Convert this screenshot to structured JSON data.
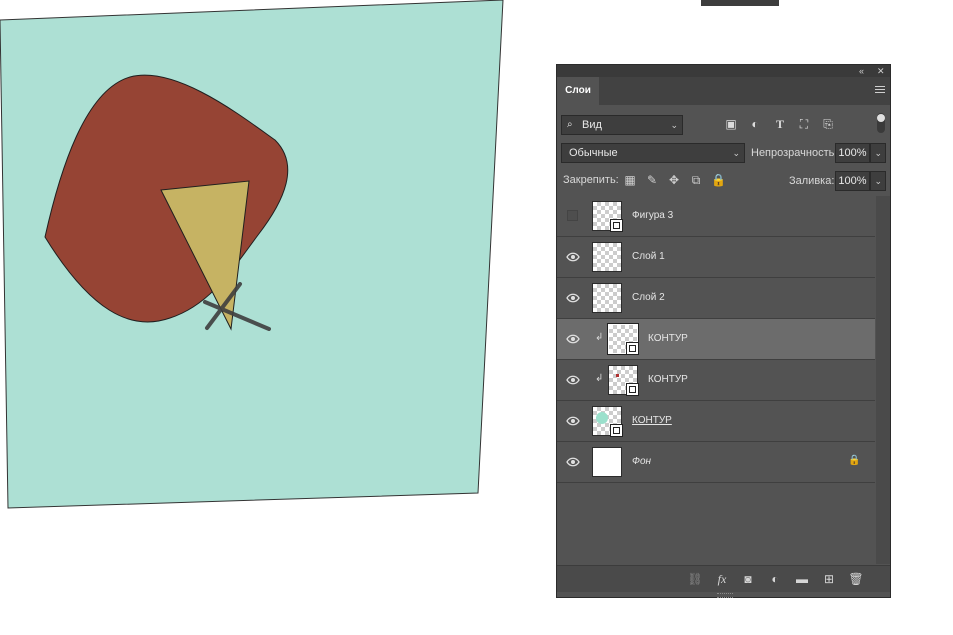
{
  "colors": {
    "canvas_bg": "#ade0d4",
    "blob": "#964434",
    "triangle": "#c6b363",
    "panel": "#535353",
    "selected_row": "#6c6c6c"
  },
  "panel": {
    "collapse_icon": "double-chevron-left-icon",
    "close_icon": "close-icon",
    "tab_label": "Слои",
    "menu_icon": "hamburger-menu-icon"
  },
  "filter": {
    "search_label": "Вид",
    "icons": [
      "image-filter-icon",
      "adjustment-filter-icon",
      "type-filter-icon",
      "shape-filter-icon",
      "smart-object-filter-icon"
    ]
  },
  "blend": {
    "mode": "Обычные",
    "opacity_label": "Непрозрачность:",
    "opacity_value": "100%"
  },
  "lock": {
    "label": "Закрепить:",
    "icons": [
      "lock-transparent-icon",
      "lock-paint-icon",
      "lock-move-icon",
      "lock-artboard-icon",
      "lock-all-icon"
    ],
    "fill_label": "Заливка:",
    "fill_value": "100%"
  },
  "layers": [
    {
      "name": "Фигура 3",
      "visible": false,
      "thumb": "vector",
      "clipped": false,
      "selected": false
    },
    {
      "name": "Слой 1",
      "visible": true,
      "thumb": "empty",
      "clipped": false,
      "selected": false
    },
    {
      "name": "Слой 2",
      "visible": true,
      "thumb": "empty",
      "clipped": false,
      "selected": false
    },
    {
      "name": "КОНТУР",
      "visible": true,
      "thumb": "vector",
      "clipped": true,
      "selected": true
    },
    {
      "name": "КОНТУР",
      "visible": true,
      "thumb": "vector",
      "clipped": true,
      "selected": false
    },
    {
      "name": "КОНТУР",
      "visible": true,
      "thumb": "vector",
      "clipped": false,
      "selected": false
    },
    {
      "name": "Фон",
      "visible": true,
      "thumb": "white",
      "clipped": false,
      "selected": false,
      "locked": true
    }
  ],
  "bottom_icons": [
    "link-layers-icon",
    "fx-icon",
    "add-mask-icon",
    "adjustment-layer-icon",
    "new-group-icon",
    "new-layer-icon",
    "trash-icon"
  ],
  "bottom_fx_label": "fx"
}
